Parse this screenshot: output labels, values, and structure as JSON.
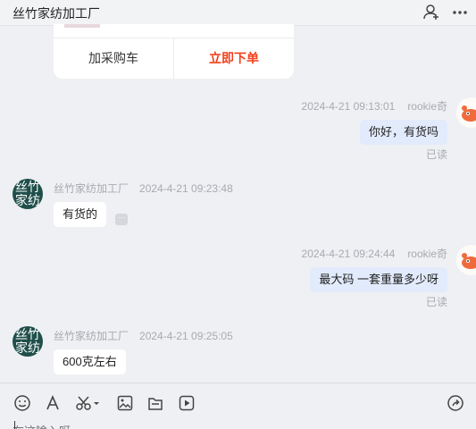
{
  "header": {
    "title": "丝竹家纺加工厂",
    "icons": [
      "add-user-icon",
      "more-icon"
    ]
  },
  "order_card": {
    "add_cart_label": "加采购车",
    "order_now_label": "立即下单",
    "accent_color": "#f0401c"
  },
  "messages": [
    {
      "from": "me",
      "name": "rookie奇",
      "time": "2024-4-21 09:13:01",
      "text": "你好，有货吗",
      "status": "已读"
    },
    {
      "from": "shop",
      "name": "丝竹家纺加工厂",
      "time": "2024-4-21 09:23:48",
      "text": "有货的"
    },
    {
      "from": "me",
      "name": "rookie奇",
      "time": "2024-4-21 09:24:44",
      "text": "最大码 一套重量多少呀",
      "status": "已读"
    },
    {
      "from": "shop",
      "name": "丝竹家纺加工厂",
      "time": "2024-4-21 09:25:05",
      "text": "600克左右"
    }
  ],
  "shop_avatar": {
    "line1": "丝竹",
    "line2": "家纺"
  },
  "toolbar": {
    "icons": [
      "emoji-icon",
      "font-icon",
      "scissors-icon",
      "image-icon",
      "file-icon",
      "video-icon",
      "share-icon"
    ],
    "input_placeholder": "在这输入呀"
  },
  "colors": {
    "outgoing_bubble": "#e2ebfc",
    "incoming_bubble": "#ffffff",
    "background": "#eff0f3"
  }
}
